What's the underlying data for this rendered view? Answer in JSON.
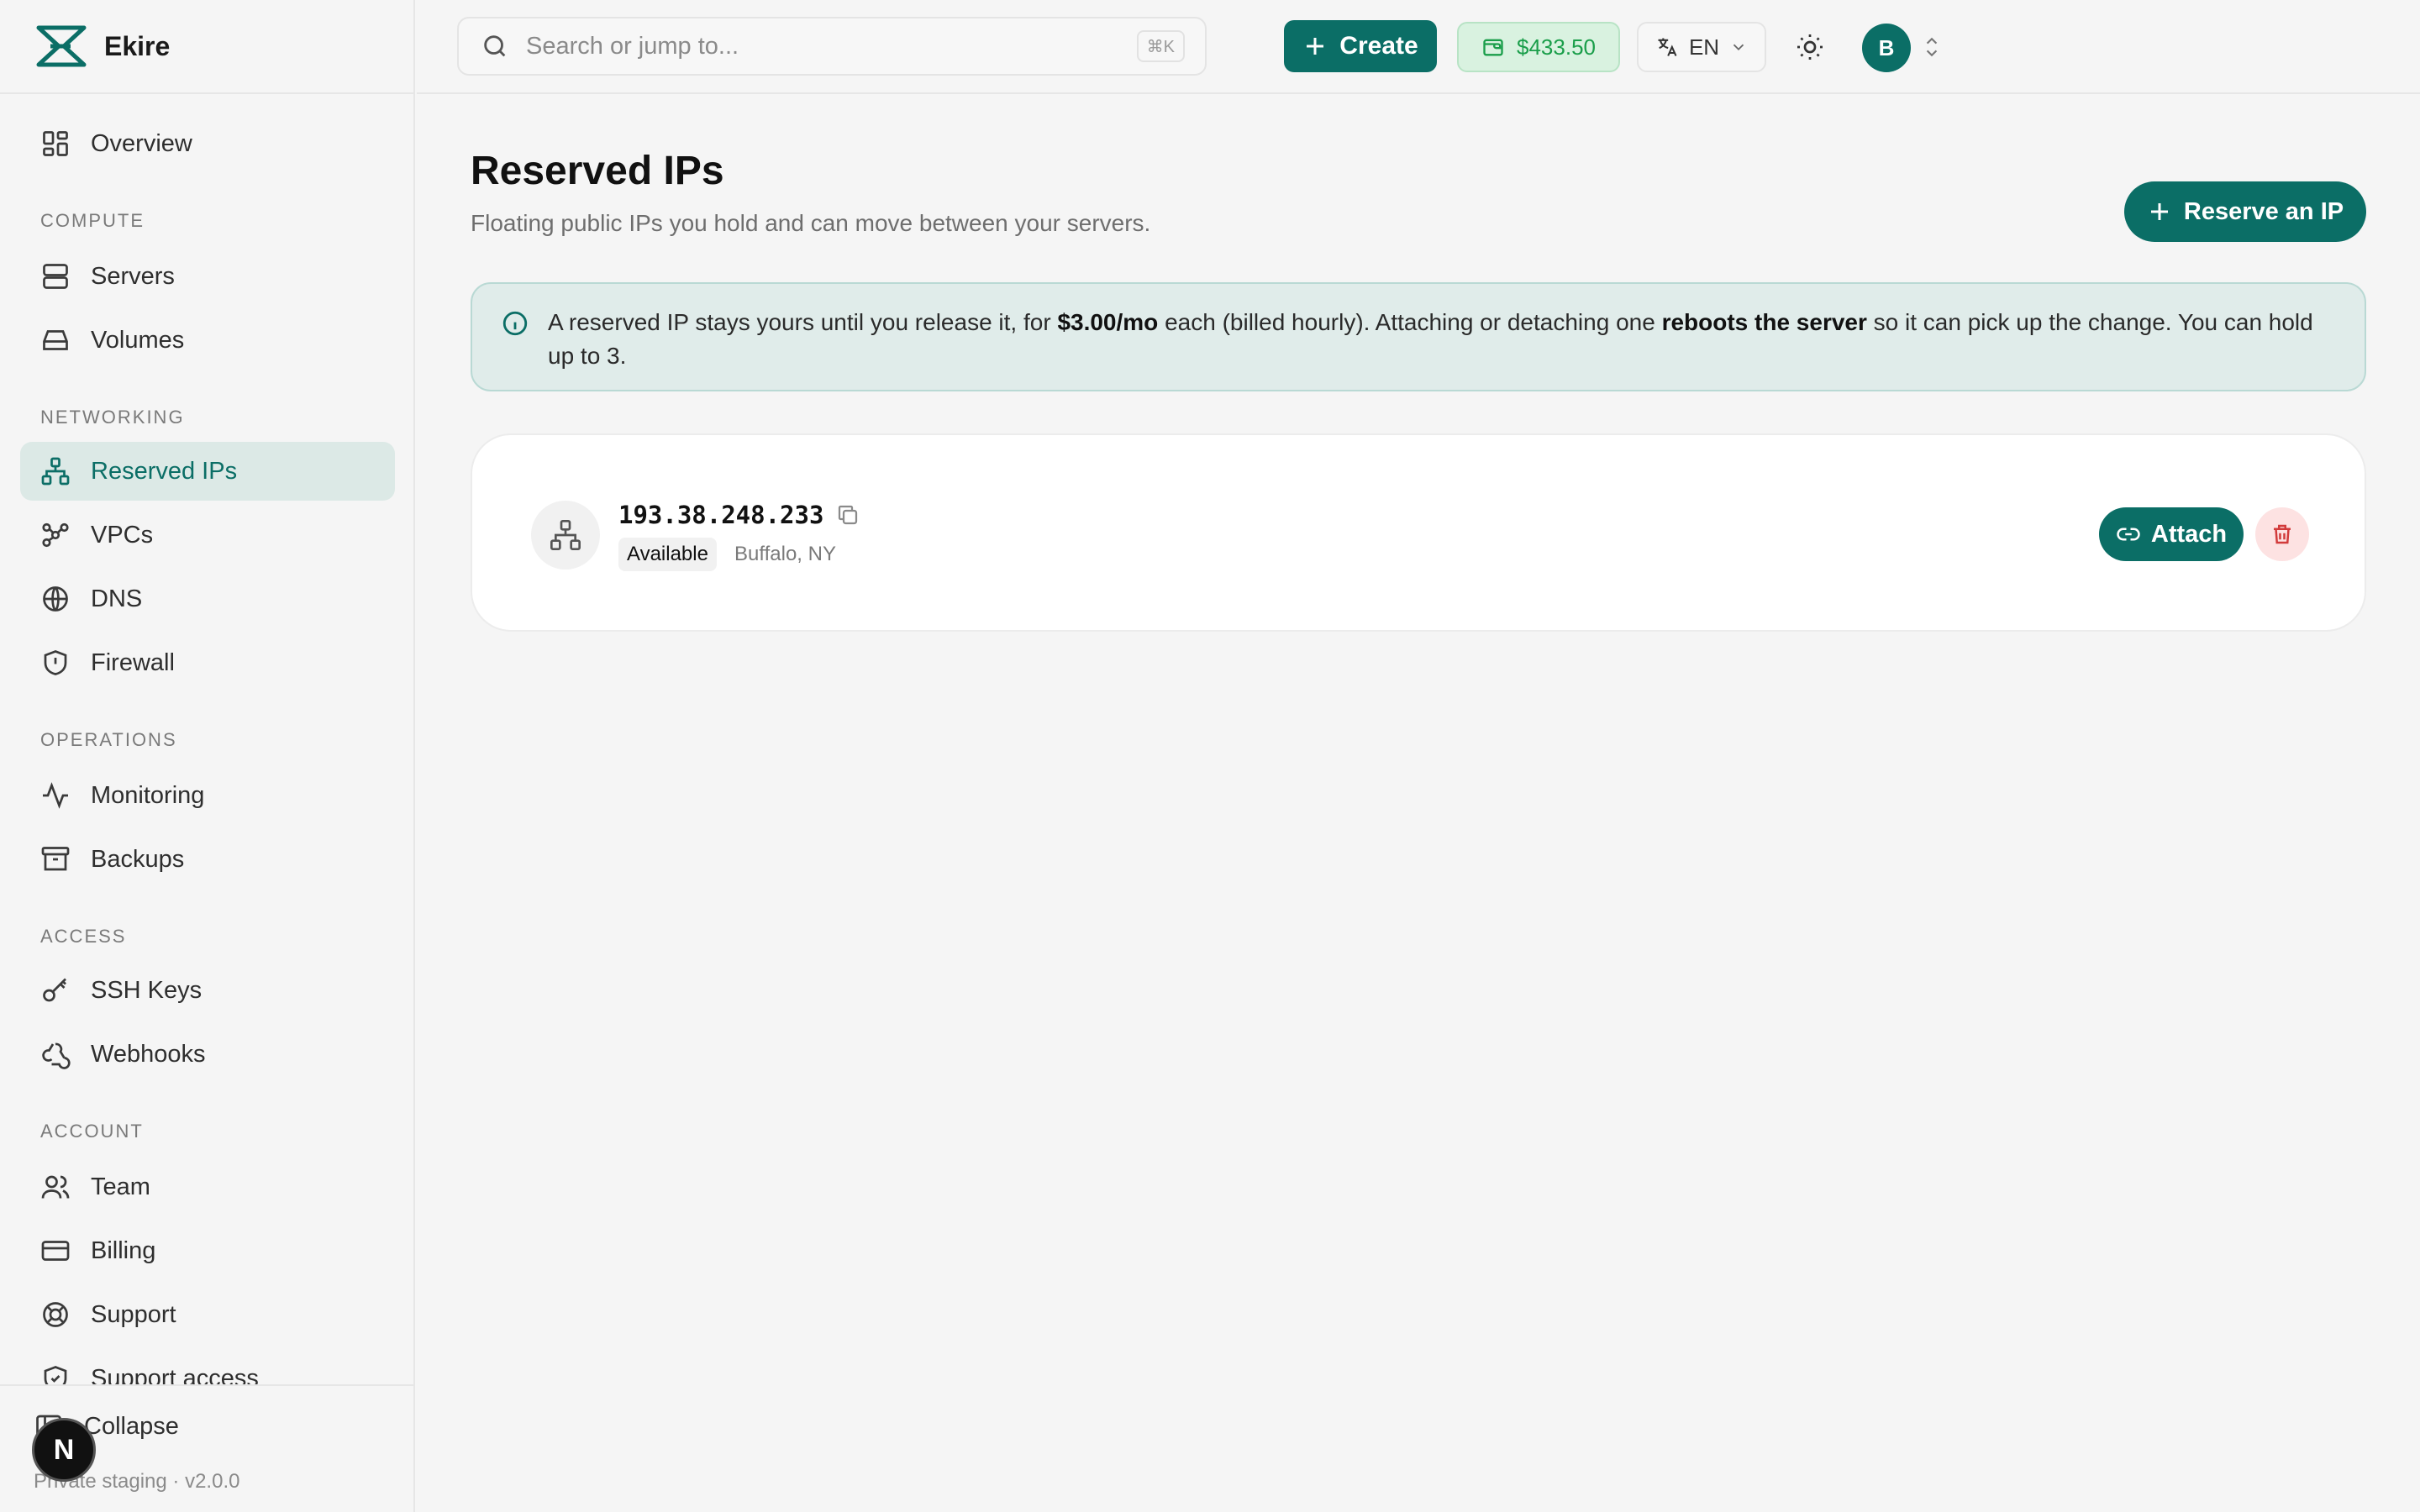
{
  "brand": {
    "name": "Ekire"
  },
  "sidebar": {
    "overview": {
      "label": "Overview",
      "icon": "grid-icon"
    },
    "sections": [
      {
        "title": "COMPUTE",
        "items": [
          {
            "label": "Servers",
            "icon": "server-icon"
          },
          {
            "label": "Volumes",
            "icon": "drive-icon"
          }
        ]
      },
      {
        "title": "NETWORKING",
        "items": [
          {
            "label": "Reserved IPs",
            "icon": "network-icon",
            "active": true
          },
          {
            "label": "VPCs",
            "icon": "vpc-icon"
          },
          {
            "label": "DNS",
            "icon": "globe-icon"
          },
          {
            "label": "Firewall",
            "icon": "shield-icon"
          }
        ]
      },
      {
        "title": "OPERATIONS",
        "items": [
          {
            "label": "Monitoring",
            "icon": "activity-icon"
          },
          {
            "label": "Backups",
            "icon": "archive-icon"
          }
        ]
      },
      {
        "title": "ACCESS",
        "items": [
          {
            "label": "SSH Keys",
            "icon": "key-icon"
          },
          {
            "label": "Webhooks",
            "icon": "webhook-icon"
          }
        ]
      },
      {
        "title": "ACCOUNT",
        "items": [
          {
            "label": "Team",
            "icon": "users-icon"
          },
          {
            "label": "Billing",
            "icon": "credit-card-icon"
          },
          {
            "label": "Support",
            "icon": "lifebuoy-icon"
          },
          {
            "label": "Support access",
            "icon": "shield-check-icon"
          }
        ]
      }
    ],
    "collapse_label": "Collapse",
    "version": "Private staging · v2.0.0",
    "n_badge": "N"
  },
  "topbar": {
    "search_placeholder": "Search or jump to...",
    "search_shortcut": "⌘K",
    "create_label": "Create",
    "balance": "$433.50",
    "language": "EN",
    "avatar_initial": "B"
  },
  "page": {
    "title": "Reserved IPs",
    "subtitle": "Floating public IPs you hold and can move between your servers.",
    "reserve_button": "Reserve an IP",
    "info": {
      "part1": "A reserved IP stays yours until you release it, for ",
      "price": "$3.00/mo",
      "part2": " each (billed hourly). Attaching or detaching one ",
      "emphasis": "reboots the server",
      "part3": " so it can pick up the change. You can hold up to 3."
    },
    "ips": [
      {
        "address": "193.38.248.233",
        "status": "Available",
        "location": "Buffalo, NY",
        "attach_label": "Attach"
      }
    ]
  },
  "colors": {
    "accent": "#0b6e66",
    "active_bg": "#dce9e6",
    "balance_green": "#1a9e4a",
    "danger": "#d23b3b"
  }
}
